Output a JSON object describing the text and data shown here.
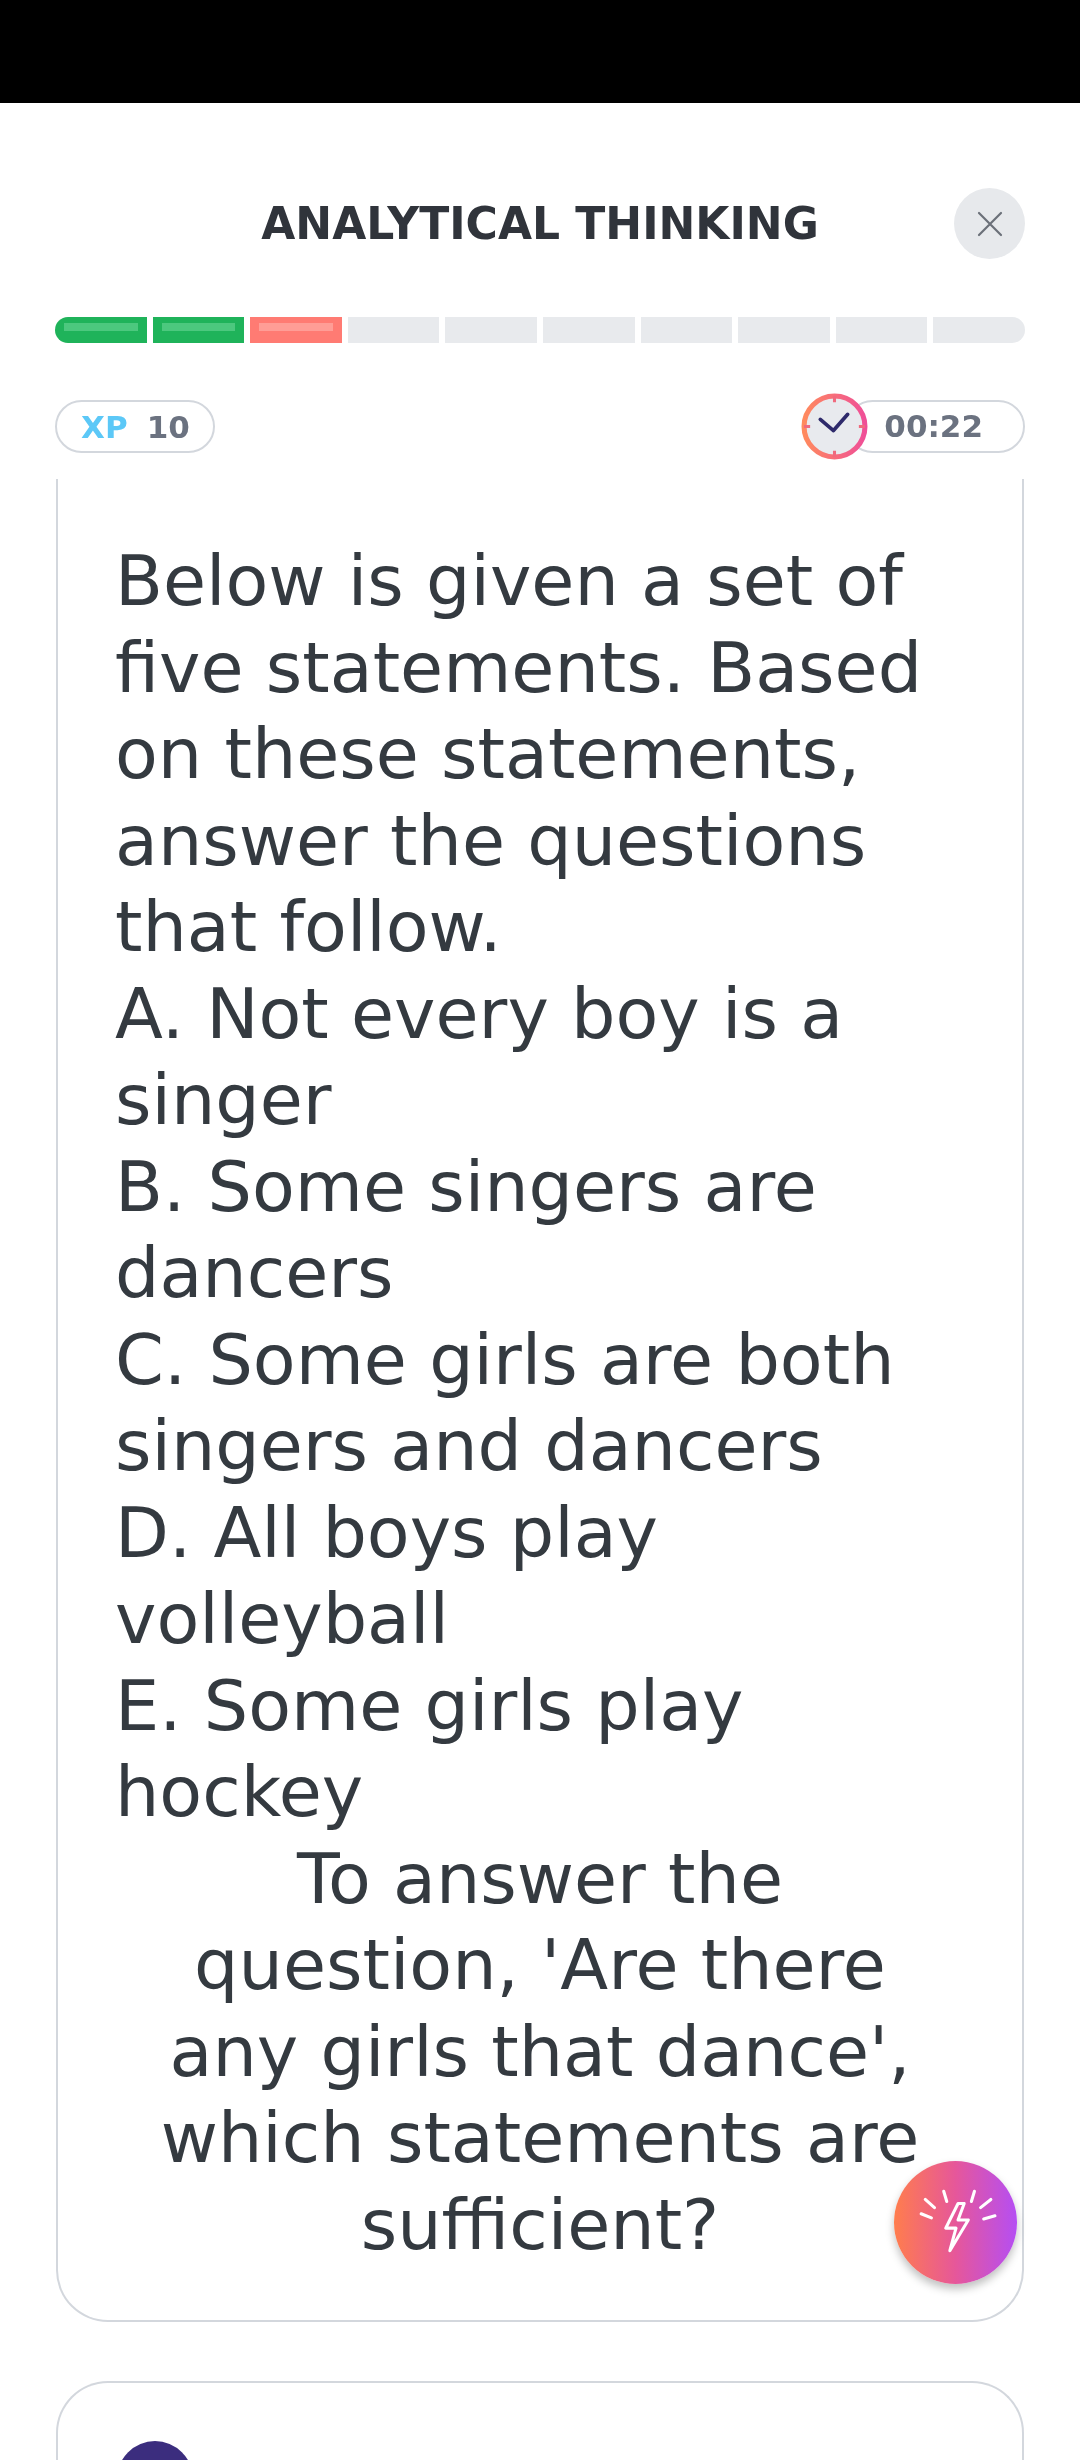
{
  "header": {
    "title": "ANALYTICAL THINKING"
  },
  "progress": [
    {
      "answered": true,
      "correct": true
    },
    {
      "answered": true,
      "correct": true
    },
    {
      "answered": true,
      "correct": false
    },
    {
      "answered": false
    },
    {
      "answered": false
    },
    {
      "answered": false
    },
    {
      "answered": false
    },
    {
      "answered": false
    },
    {
      "answered": false
    },
    {
      "answered": false
    }
  ],
  "xp": {
    "label": "XP",
    "value": "10"
  },
  "timer": {
    "time": "00:22"
  },
  "question_card": {
    "intro": "Below is given a set of five statements. Based on these statements, answer the questions that follow.",
    "statements": [
      "A. Not every boy is a singer",
      "B. Some singers are dancers",
      "C. Some girls are both singers and dancers",
      "D. All boys play volleyball",
      "E. Some girls play hockey"
    ],
    "question": "To answer the question, 'Are there any girls that dance', which statements are sufficient?"
  }
}
